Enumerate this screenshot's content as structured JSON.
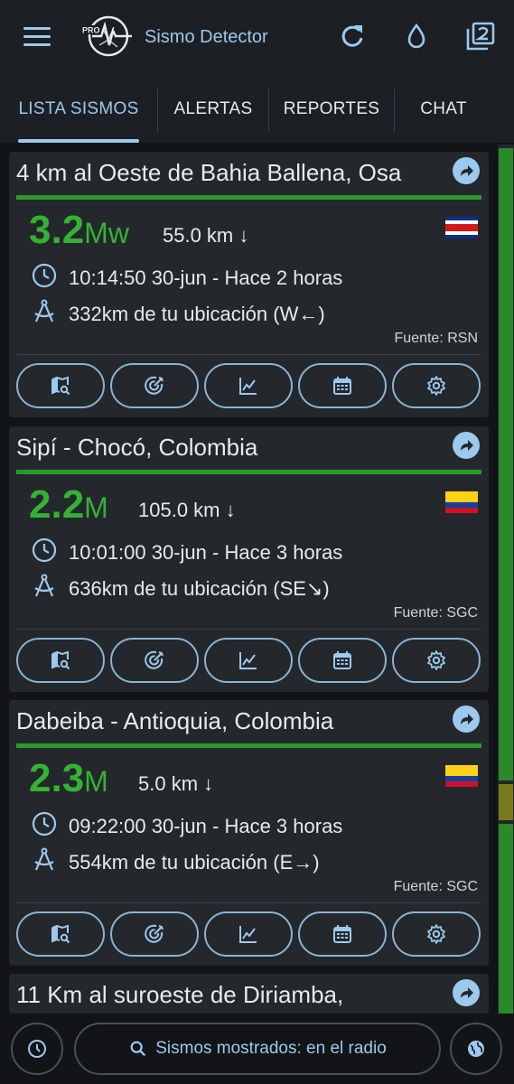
{
  "app": {
    "title": "Sismo Detector",
    "logo_badge": "PRO"
  },
  "appbar": {
    "icons": [
      "menu-icon",
      "refresh-icon",
      "water-drop-icon",
      "filter-2-icon"
    ]
  },
  "tabs": [
    {
      "label": "LISTA SISMOS",
      "active": true
    },
    {
      "label": "ALERTAS",
      "active": false
    },
    {
      "label": "REPORTES",
      "active": false
    },
    {
      "label": "CHAT",
      "active": false
    }
  ],
  "colors": {
    "accent": "#9cc9ee",
    "magnitude": "#34b234",
    "card": "#24272b",
    "background": "#121417"
  },
  "quakes": [
    {
      "title": "4 km al Oeste de Bahia Ballena, Osa",
      "mag_value": "3.2",
      "mag_unit": "Mw",
      "depth": "55.0 km ↓",
      "time": "10:14:50 30-jun - Hace 2 horas",
      "distance": "332km de tu ubicación (W←)",
      "source": "Fuente: RSN",
      "country_flag": "costa-rica-flag"
    },
    {
      "title": "Sipí - Chocó, Colombia",
      "mag_value": "2.2",
      "mag_unit": "M",
      "depth": "105.0 km ↓",
      "time": "10:01:00 30-jun - Hace 3 horas",
      "distance": "636km de tu ubicación (SE↘)",
      "source": "Fuente: SGC",
      "country_flag": "colombia-flag"
    },
    {
      "title": "Dabeiba - Antioquia, Colombia",
      "mag_value": "2.3",
      "mag_unit": "M",
      "depth": "5.0 km ↓",
      "time": "09:22:00 30-jun - Hace 3 horas",
      "distance": "554km de tu ubicación (E→)",
      "source": "Fuente: SGC",
      "country_flag": "colombia-flag"
    },
    {
      "title": "11 Km al suroeste de Diriamba,"
    }
  ],
  "card_actions": [
    "map-search-icon",
    "radar-target-icon",
    "chart-line-icon",
    "calendar-icon",
    "settings-gear-icon"
  ],
  "bottom": {
    "filter_label": "Sismos mostrados: en el radio",
    "icons": [
      "history-clock-icon",
      "search-icon",
      "globe-icon"
    ]
  }
}
